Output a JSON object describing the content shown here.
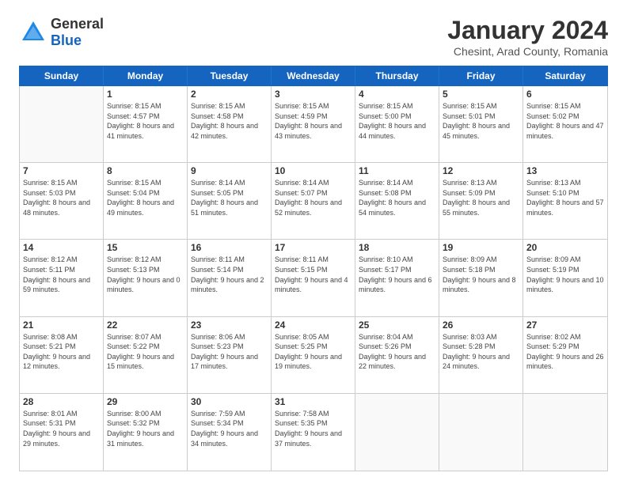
{
  "header": {
    "logo_line1": "General",
    "logo_line2": "Blue",
    "month_title": "January 2024",
    "subtitle": "Chesint, Arad County, Romania"
  },
  "weekdays": [
    "Sunday",
    "Monday",
    "Tuesday",
    "Wednesday",
    "Thursday",
    "Friday",
    "Saturday"
  ],
  "weeks": [
    [
      {
        "day": "",
        "empty": true
      },
      {
        "day": "1",
        "sunrise": "8:15 AM",
        "sunset": "4:57 PM",
        "daylight": "8 hours and 41 minutes."
      },
      {
        "day": "2",
        "sunrise": "8:15 AM",
        "sunset": "4:58 PM",
        "daylight": "8 hours and 42 minutes."
      },
      {
        "day": "3",
        "sunrise": "8:15 AM",
        "sunset": "4:59 PM",
        "daylight": "8 hours and 43 minutes."
      },
      {
        "day": "4",
        "sunrise": "8:15 AM",
        "sunset": "5:00 PM",
        "daylight": "8 hours and 44 minutes."
      },
      {
        "day": "5",
        "sunrise": "8:15 AM",
        "sunset": "5:01 PM",
        "daylight": "8 hours and 45 minutes."
      },
      {
        "day": "6",
        "sunrise": "8:15 AM",
        "sunset": "5:02 PM",
        "daylight": "8 hours and 47 minutes."
      }
    ],
    [
      {
        "day": "7",
        "sunrise": "8:15 AM",
        "sunset": "5:03 PM",
        "daylight": "8 hours and 48 minutes."
      },
      {
        "day": "8",
        "sunrise": "8:15 AM",
        "sunset": "5:04 PM",
        "daylight": "8 hours and 49 minutes."
      },
      {
        "day": "9",
        "sunrise": "8:14 AM",
        "sunset": "5:05 PM",
        "daylight": "8 hours and 51 minutes."
      },
      {
        "day": "10",
        "sunrise": "8:14 AM",
        "sunset": "5:07 PM",
        "daylight": "8 hours and 52 minutes."
      },
      {
        "day": "11",
        "sunrise": "8:14 AM",
        "sunset": "5:08 PM",
        "daylight": "8 hours and 54 minutes."
      },
      {
        "day": "12",
        "sunrise": "8:13 AM",
        "sunset": "5:09 PM",
        "daylight": "8 hours and 55 minutes."
      },
      {
        "day": "13",
        "sunrise": "8:13 AM",
        "sunset": "5:10 PM",
        "daylight": "8 hours and 57 minutes."
      }
    ],
    [
      {
        "day": "14",
        "sunrise": "8:12 AM",
        "sunset": "5:11 PM",
        "daylight": "8 hours and 59 minutes."
      },
      {
        "day": "15",
        "sunrise": "8:12 AM",
        "sunset": "5:13 PM",
        "daylight": "9 hours and 0 minutes."
      },
      {
        "day": "16",
        "sunrise": "8:11 AM",
        "sunset": "5:14 PM",
        "daylight": "9 hours and 2 minutes."
      },
      {
        "day": "17",
        "sunrise": "8:11 AM",
        "sunset": "5:15 PM",
        "daylight": "9 hours and 4 minutes."
      },
      {
        "day": "18",
        "sunrise": "8:10 AM",
        "sunset": "5:17 PM",
        "daylight": "9 hours and 6 minutes."
      },
      {
        "day": "19",
        "sunrise": "8:09 AM",
        "sunset": "5:18 PM",
        "daylight": "9 hours and 8 minutes."
      },
      {
        "day": "20",
        "sunrise": "8:09 AM",
        "sunset": "5:19 PM",
        "daylight": "9 hours and 10 minutes."
      }
    ],
    [
      {
        "day": "21",
        "sunrise": "8:08 AM",
        "sunset": "5:21 PM",
        "daylight": "9 hours and 12 minutes."
      },
      {
        "day": "22",
        "sunrise": "8:07 AM",
        "sunset": "5:22 PM",
        "daylight": "9 hours and 15 minutes."
      },
      {
        "day": "23",
        "sunrise": "8:06 AM",
        "sunset": "5:23 PM",
        "daylight": "9 hours and 17 minutes."
      },
      {
        "day": "24",
        "sunrise": "8:05 AM",
        "sunset": "5:25 PM",
        "daylight": "9 hours and 19 minutes."
      },
      {
        "day": "25",
        "sunrise": "8:04 AM",
        "sunset": "5:26 PM",
        "daylight": "9 hours and 22 minutes."
      },
      {
        "day": "26",
        "sunrise": "8:03 AM",
        "sunset": "5:28 PM",
        "daylight": "9 hours and 24 minutes."
      },
      {
        "day": "27",
        "sunrise": "8:02 AM",
        "sunset": "5:29 PM",
        "daylight": "9 hours and 26 minutes."
      }
    ],
    [
      {
        "day": "28",
        "sunrise": "8:01 AM",
        "sunset": "5:31 PM",
        "daylight": "9 hours and 29 minutes."
      },
      {
        "day": "29",
        "sunrise": "8:00 AM",
        "sunset": "5:32 PM",
        "daylight": "9 hours and 31 minutes."
      },
      {
        "day": "30",
        "sunrise": "7:59 AM",
        "sunset": "5:34 PM",
        "daylight": "9 hours and 34 minutes."
      },
      {
        "day": "31",
        "sunrise": "7:58 AM",
        "sunset": "5:35 PM",
        "daylight": "9 hours and 37 minutes."
      },
      {
        "day": "",
        "empty": true
      },
      {
        "day": "",
        "empty": true
      },
      {
        "day": "",
        "empty": true
      }
    ]
  ]
}
